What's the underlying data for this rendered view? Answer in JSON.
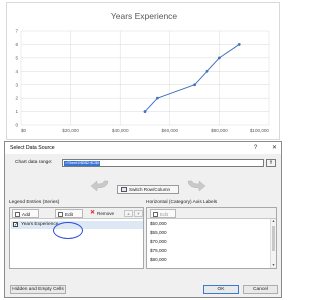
{
  "chart_data": {
    "type": "scatter",
    "title": "Years Experience",
    "series": [
      {
        "name": "Years Experience",
        "points": [
          {
            "x": 50000,
            "y": 1
          },
          {
            "x": 55000,
            "y": 2
          },
          {
            "x": 70000,
            "y": 3
          },
          {
            "x": 75000,
            "y": 4
          },
          {
            "x": 80000,
            "y": 5
          },
          {
            "x": 88000,
            "y": 6
          }
        ],
        "color": "#4472c4"
      }
    ],
    "x_ticks": [
      "$0",
      "$20,000",
      "$40,000",
      "$60,000",
      "$80,000",
      "$100,000"
    ],
    "y_ticks": [
      "0",
      "1",
      "2",
      "3",
      "4",
      "5",
      "6",
      "7"
    ],
    "xlim": [
      0,
      100000
    ],
    "ylim": [
      0,
      7
    ],
    "grid": true,
    "legend": "none"
  },
  "dialog": {
    "title": "Select Data Source",
    "help": "?",
    "close": "✕",
    "range_label": "Chart data range:",
    "range_value": "=Sheet1!$B$2:$C$9",
    "switch_label": "Switch Row/Column",
    "legend_label": "Legend Entries (Series)",
    "add_label": "Add",
    "edit_label": "Edit",
    "remove_label": "Remove",
    "up": "▲",
    "down": "▼",
    "series": [
      "Years Experience"
    ],
    "axis_label": "Horizontal (Category) Axis Labels",
    "axis_edit_label": "Edit",
    "axis_items": [
      "$50,000",
      "$55,000",
      "$70,000",
      "$75,000",
      "$80,000"
    ],
    "hidden_cells_label": "Hidden and Empty Cells",
    "ok_label": "OK",
    "cancel_label": "Cancel"
  }
}
